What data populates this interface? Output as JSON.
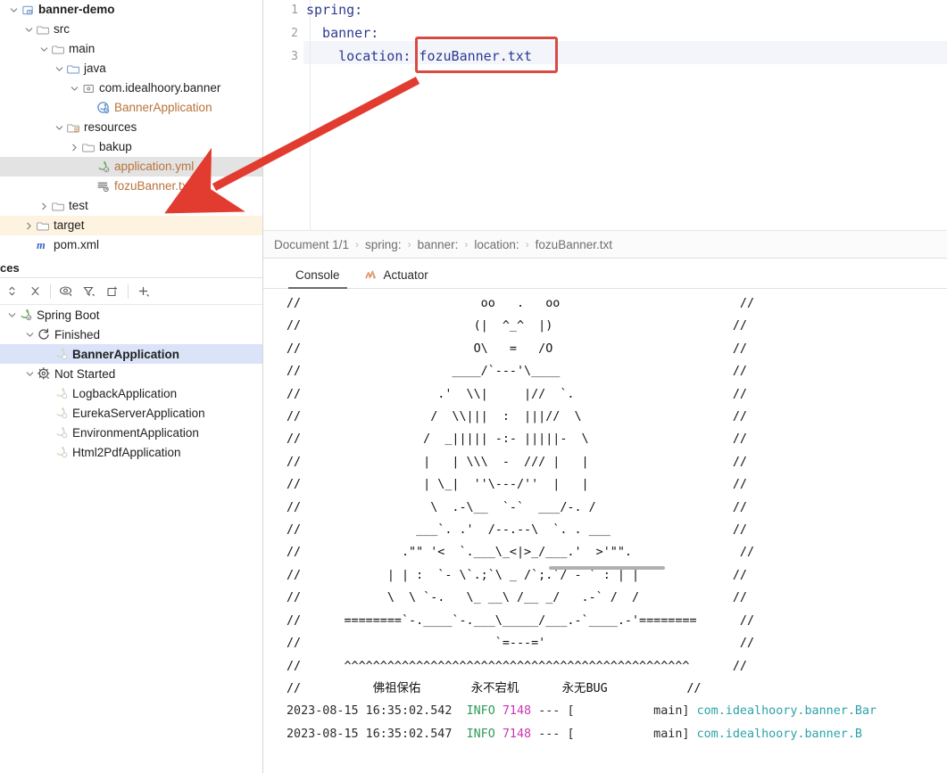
{
  "project_tree": {
    "rows": [
      {
        "label": "banner-demo",
        "indent": 0,
        "chevron": "down",
        "icon": "module-icon",
        "bold": true,
        "color": "default",
        "state": "normal"
      },
      {
        "label": "src",
        "indent": 1,
        "chevron": "down",
        "icon": "folder-icon",
        "bold": false,
        "color": "default",
        "state": "normal"
      },
      {
        "label": "main",
        "indent": 2,
        "chevron": "down",
        "icon": "folder-icon",
        "bold": false,
        "color": "default",
        "state": "normal"
      },
      {
        "label": "java",
        "indent": 3,
        "chevron": "down",
        "icon": "source-folder-icon",
        "bold": false,
        "color": "default",
        "state": "normal"
      },
      {
        "label": "com.idealhoory.banner",
        "indent": 4,
        "chevron": "down",
        "icon": "package-icon",
        "bold": false,
        "color": "default",
        "state": "normal"
      },
      {
        "label": "BannerApplication",
        "indent": 5,
        "chevron": "none",
        "icon": "spring-class-icon",
        "bold": false,
        "color": "modified",
        "state": "normal"
      },
      {
        "label": "resources",
        "indent": 3,
        "chevron": "down",
        "icon": "resources-folder-icon",
        "bold": false,
        "color": "default",
        "state": "normal"
      },
      {
        "label": "bakup",
        "indent": 4,
        "chevron": "right",
        "icon": "folder-icon",
        "bold": false,
        "color": "default",
        "state": "normal"
      },
      {
        "label": "application.yml",
        "indent": 5,
        "chevron": "none",
        "icon": "spring-yaml-icon",
        "bold": false,
        "color": "modified",
        "state": "selected"
      },
      {
        "label": "fozuBanner.txt",
        "indent": 5,
        "chevron": "none",
        "icon": "text-file-icon",
        "bold": false,
        "color": "modified",
        "state": "normal"
      },
      {
        "label": "test",
        "indent": 2,
        "chevron": "right",
        "icon": "folder-icon",
        "bold": false,
        "color": "default",
        "state": "normal"
      },
      {
        "label": "target",
        "indent": 1,
        "chevron": "right",
        "icon": "folder-icon",
        "bold": false,
        "color": "default",
        "state": "excluded"
      },
      {
        "label": "pom.xml",
        "indent": 1,
        "chevron": "none",
        "icon": "maven-icon",
        "bold": false,
        "color": "default",
        "state": "normal"
      }
    ]
  },
  "services": {
    "title": "ces",
    "toolbar_icons": [
      "expand-collapse-icon",
      "collapse-all-icon",
      "show-hide-icon",
      "filter-icon",
      "export-icon",
      "add-icon"
    ],
    "rows": [
      {
        "label": "Spring Boot",
        "indent": 0,
        "chevron": "down",
        "icon": "spring-boot-icon",
        "bold": false,
        "state": "normal"
      },
      {
        "label": "Finished",
        "indent": 1,
        "chevron": "down",
        "icon": "rerun-icon",
        "bold": false,
        "state": "normal"
      },
      {
        "label": "BannerApplication",
        "indent": 2,
        "chevron": "none",
        "icon": "spring-run-icon",
        "bold": true,
        "state": "selected"
      },
      {
        "label": "Not Started",
        "indent": 1,
        "chevron": "down",
        "icon": "gear-icon",
        "bold": false,
        "state": "normal"
      },
      {
        "label": "LogbackApplication",
        "indent": 2,
        "chevron": "none",
        "icon": "spring-run-icon",
        "bold": false,
        "state": "normal"
      },
      {
        "label": "EurekaServerApplication",
        "indent": 2,
        "chevron": "none",
        "icon": "spring-run-icon",
        "bold": false,
        "state": "normal"
      },
      {
        "label": "EnvironmentApplication",
        "indent": 2,
        "chevron": "none",
        "icon": "spring-run-icon",
        "bold": false,
        "state": "normal"
      },
      {
        "label": "Html2PdfApplication",
        "indent": 2,
        "chevron": "none",
        "icon": "spring-run-icon",
        "bold": false,
        "state": "normal"
      }
    ]
  },
  "editor": {
    "line_numbers": [
      "1",
      "2",
      "3"
    ],
    "lines": [
      "spring:",
      "  banner:",
      "    location: fozuBanner.txt"
    ],
    "highlighted_value": "fozuBanner.txt",
    "highlight_color": "#d94a42",
    "annotation": {
      "type": "red-arrow",
      "color": "#e23b30"
    }
  },
  "breadcrumb": {
    "items": [
      "Document 1/1",
      "spring:",
      "banner:",
      "location:",
      "fozuBanner.txt"
    ],
    "separator": "›"
  },
  "console": {
    "tabs": [
      {
        "label": "Console",
        "icon": "console-icon",
        "active": true
      },
      {
        "label": "Actuator",
        "icon": "actuator-icon",
        "active": false
      }
    ],
    "ascii_banner": "//                         oo   .   oo                         //\n//                        (|  ^_^  |)                         //\n//                        O\\   =   /O                         //\n//                     ____/`---'\\____                        //\n//                   .'  \\\\|     |//  `.                      //\n//                  /  \\\\|||  :  |||//  \\                     //\n//                 /  _||||| -:- |||||-  \\                    //\n//                 |   | \\\\\\  -  /// |   |                    //\n//                 | \\_|  ''\\---/''  |   |                    //\n//                  \\  .-\\__  `-`  ___/-. /                   //\n//                ___`. .'  /--.--\\  `. . ___                 //\n//              .\"\" '<  `.___\\_<|>_/___.'  >'\"\".               //\n//            | | :  `- \\`.;`\\ _ /`;.`/ - ` : | |             //\n//            \\  \\ `-.   \\_ __\\ /__ _/   .-` /  /             //\n//      ========`-.____`-.___\\_____/___.-`____.-'========      //\n//                           `=---='                           //\n//      ^^^^^^^^^^^^^^^^^^^^^^^^^^^^^^^^^^^^^^^^^^^^^^^^      //\n//          佛祖保佑       永不宕机      永无BUG           //",
    "banner_text_lines": [
      "佛祖保佑",
      "永不宕机",
      "永无BUG"
    ],
    "log_lines": [
      {
        "timestamp": "2023-08-15 16:35:02.542",
        "level": "INFO",
        "pid": "7148",
        "dashes": "---",
        "thread": "[           main]",
        "logger": "com.idealhoory.banner.Bar"
      },
      {
        "timestamp": "2023-08-15 16:35:02.547",
        "level": "INFO",
        "pid": "7148",
        "dashes": "---",
        "thread": "[           main]",
        "logger": "com.idealhoory.banner.B"
      }
    ]
  },
  "colors": {
    "accent_red": "#e23b30",
    "selection_blue": "#dbe3f8",
    "selection_gray": "#e3e3e3",
    "excluded_orange": "#fdf3e0",
    "modified_text": "#b8733a",
    "code_blue": "#2b3a8f",
    "log_info_green": "#2e9b5b",
    "log_pid_magenta": "#c838b0",
    "log_class_cyan": "#2aa3a8"
  }
}
